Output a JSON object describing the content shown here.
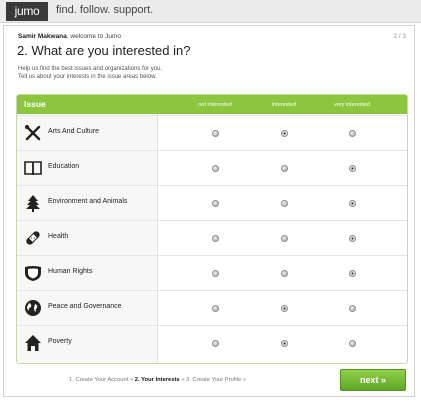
{
  "header": {
    "logo": "jumo",
    "tagline": "find. follow. support."
  },
  "intro": {
    "user_name": "Samir Makwana",
    "welcome_suffix": ", welcome to Jumo",
    "step_count": "2 / 3",
    "title": "2. What are you interested in?",
    "help_line1": "Help us find the best issues and organizations for you.",
    "help_line2": "Tell us about your interests in the issue areas below."
  },
  "table": {
    "columns": {
      "issue": "Issue",
      "not_interested": "not interested",
      "interested": "interested",
      "very_interested": "very interested"
    },
    "rows": [
      {
        "label": "Arts And Culture",
        "icon": "arts-culture-icon",
        "selected": "interested"
      },
      {
        "label": "Education",
        "icon": "book-icon",
        "selected": "very_interested"
      },
      {
        "label": "Environment and Animals",
        "icon": "tree-icon",
        "selected": "very_interested"
      },
      {
        "label": "Health",
        "icon": "bandage-icon",
        "selected": "very_interested"
      },
      {
        "label": "Human Rights",
        "icon": "shield-icon",
        "selected": "very_interested"
      },
      {
        "label": "Peace and Governance",
        "icon": "globe-icon",
        "selected": "interested"
      },
      {
        "label": "Poverty",
        "icon": "house-icon",
        "selected": "interested"
      }
    ]
  },
  "footer": {
    "step1": "1. Create Your Account",
    "sep1": " » ",
    "step2": "2. Your Interests",
    "sep2": " » ",
    "step3": "3. Create Your Profile",
    "sep3": " »",
    "next_label": "next »"
  },
  "colors": {
    "accent_green": "#8cc63f",
    "button_green": "#5fa624"
  }
}
